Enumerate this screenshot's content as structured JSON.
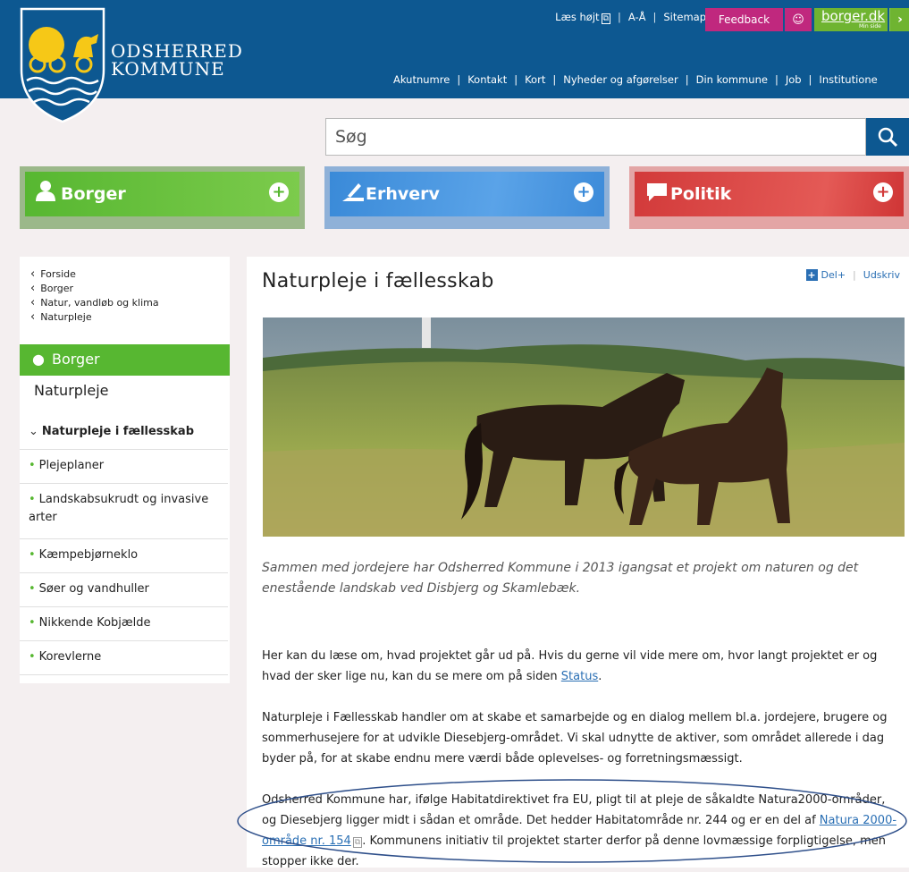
{
  "header": {
    "brand_line1": "ODSHERRED",
    "brand_line2": "KOMMUNE",
    "top_links": [
      "Læs højt",
      "A-Å",
      "Sitemap"
    ],
    "feedback_label": "Feedback",
    "smile_glyph": "☺",
    "borgerdk_label": "borger.dk",
    "borgerdk_sub": "Min side",
    "borgerdk_arrow": "›",
    "main_nav": [
      "Akutnumre",
      "Kontakt",
      "Kort",
      "Nyheder og afgørelser",
      "Din kommune",
      "Job",
      "Institutione"
    ],
    "colors": {
      "header_bg": "#0d5891",
      "feedback": "#c0287e",
      "borgerdk": "#6fb431"
    }
  },
  "search": {
    "placeholder": "Søg",
    "icon": "search-icon"
  },
  "tiles": {
    "borger": {
      "label": "Borger",
      "icon": "person-icon",
      "plus": "+"
    },
    "erhverv": {
      "label": "Erhverv",
      "icon": "ruler-icon",
      "plus": "+"
    },
    "politik": {
      "label": "Politik",
      "icon": "speech-bubble-icon",
      "plus": "+"
    }
  },
  "sidebar": {
    "breadcrumbs": [
      "Forside",
      "Borger",
      "Natur, vandløb og klima",
      "Naturpleje"
    ],
    "section": "Borger",
    "title": "Naturpleje",
    "items": [
      {
        "label": "Naturpleje i fællesskab",
        "active": true
      },
      {
        "label": "Plejeplaner"
      },
      {
        "label": "Landskabsukrudt og invasive arter"
      },
      {
        "label": "Kæmpebjørneklo"
      },
      {
        "label": "Søer og vandhuller"
      },
      {
        "label": "Nikkende Kobjælde"
      },
      {
        "label": "Korevlerne"
      }
    ]
  },
  "content": {
    "title": "Naturpleje i fællesskab",
    "share_label": "Del+",
    "print_label": "Udskriv",
    "lead": "Sammen med jordejere har Odsherred Kommune i 2013 igangsat et projekt om naturen og det enestående landskab ved Disbjerg og Skamlebæk.",
    "p1_text": "Her kan du læse om, hvad projektet går ud på. Hvis du gerne vil vide mere om, hvor langt projektet er og hvad der sker lige nu, kan du se mere om på siden ",
    "p1_link": "Status",
    "p1_end": ".",
    "p2": "Naturpleje i Fællesskab handler om at skabe et samarbejde og en dialog mellem bl.a. jordejere, brugere og sommerhusejere for at udvikle Diesebjerg-området. Vi skal udnytte de aktiver, som området allerede i dag byder på, for at skabe endnu mere værdi både oplevelses- og forretningsmæssigt.",
    "p3_text": "Odsherred Kommune har, ifølge Habitatdirektivet fra EU, pligt til at pleje de såkaldte Natura2000-områder, og Diesebjerg ligger midt i sådan et område. Det hedder Habitatområde nr. 244 og er en del af ",
    "p3_link": "Natura 2000-område nr. 154",
    "p3_end": ". Kommunens initiativ til projektet starter derfor på denne lovmæssige forpligtigelse, men stopper ikke der."
  }
}
